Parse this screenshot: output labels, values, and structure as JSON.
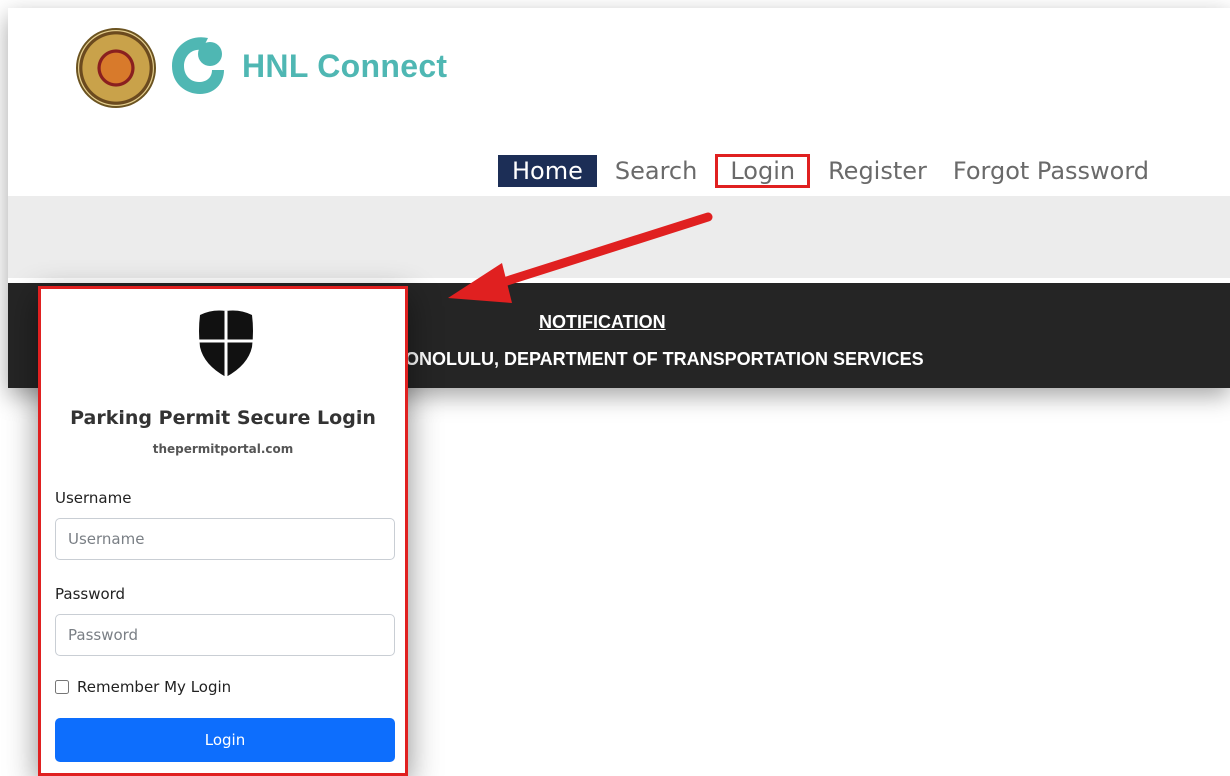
{
  "brand": {
    "name": "HNL Connect",
    "accent": "#4fb7b3",
    "seal_icon": "city-seal-icon"
  },
  "nav": {
    "items": [
      {
        "label": "Home"
      },
      {
        "label": "Search"
      },
      {
        "label": "Login"
      },
      {
        "label": "Register"
      },
      {
        "label": "Forgot Password"
      }
    ],
    "active_color": "#1c2e56",
    "highlight_color": "#e02020"
  },
  "notification": {
    "title": "NOTIFICATION",
    "subtitle": "HONOLULU, DEPARTMENT OF TRANSPORTATION SERVICES"
  },
  "login_card": {
    "icon": "shield-icon",
    "title": "Parking Permit Secure Login",
    "site": "thepermitportal.com",
    "username_label": "Username",
    "username_placeholder": "Username",
    "password_label": "Password",
    "password_placeholder": "Password",
    "remember_label": "Remember My Login",
    "remember_checked": false,
    "submit_label": "Login",
    "button_color": "#0d6efd",
    "border_color": "#e02020"
  }
}
